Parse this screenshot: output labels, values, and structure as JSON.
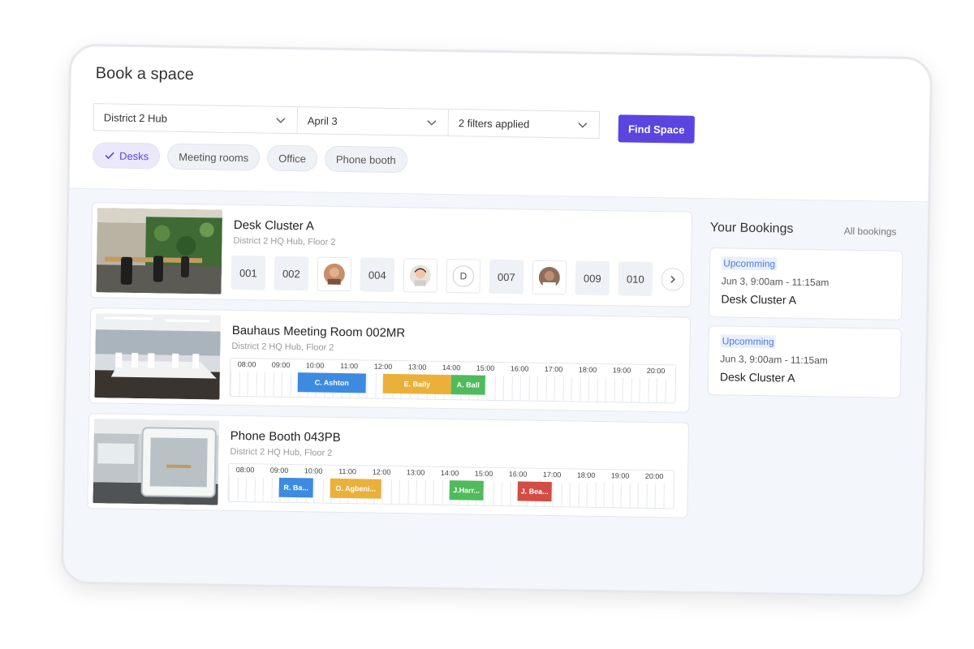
{
  "header": {
    "title": "Book a space"
  },
  "filters": {
    "location": "District 2 Hub",
    "date": "April 3",
    "filters": "2 filters applied",
    "find_label": "Find Space"
  },
  "chips": [
    {
      "label": "Desks",
      "active": true
    },
    {
      "label": "Meeting rooms",
      "active": false
    },
    {
      "label": "Office",
      "active": false
    },
    {
      "label": "Phone booth",
      "active": false
    }
  ],
  "spaces": [
    {
      "name": "Desk Cluster A",
      "location": "District 2 HQ Hub, Floor 2",
      "seats": [
        "001",
        "002",
        "",
        "004",
        "",
        "D",
        "007",
        "",
        "009",
        "010"
      ]
    },
    {
      "name": "Bauhaus Meeting Room 002MR",
      "location": "District 2 HQ Hub, Floor 2",
      "hours": [
        "08:00",
        "09:00",
        "10:00",
        "11:00",
        "12:00",
        "13:00",
        "14:00",
        "15:00",
        "16:00",
        "17:00",
        "18:00",
        "19:00",
        "20:00"
      ],
      "bookings": [
        {
          "label": "C. Ashton",
          "start": 9.5,
          "end": 11.5,
          "color": "#3d8be0"
        },
        {
          "label": "E. Baily",
          "start": 12.0,
          "end": 14.0,
          "color": "#eab03a"
        },
        {
          "label": "A. Ball",
          "start": 14.0,
          "end": 15.0,
          "color": "#4fbb5c"
        }
      ]
    },
    {
      "name": "Phone Booth 043PB",
      "location": "District 2 HQ Hub, Floor 2",
      "hours": [
        "08:00",
        "09:00",
        "10:00",
        "11:00",
        "12:00",
        "13:00",
        "14:00",
        "15:00",
        "16:00",
        "17:00",
        "18:00",
        "19:00",
        "20:00"
      ],
      "bookings": [
        {
          "label": "R. Ba...",
          "start": 9.0,
          "end": 10.0,
          "color": "#3d8be0"
        },
        {
          "label": "O. Agbeni...",
          "start": 10.5,
          "end": 12.0,
          "color": "#eab03a"
        },
        {
          "label": "J.Harr...",
          "start": 14.0,
          "end": 15.0,
          "color": "#4fbb5c"
        },
        {
          "label": "J. Bea...",
          "start": 16.0,
          "end": 17.0,
          "color": "#d24d43"
        }
      ]
    }
  ],
  "bookings_panel": {
    "title": "Your Bookings",
    "all_link": "All bookings",
    "items": [
      {
        "status": "Upcomming",
        "time": "Jun 3, 9:00am - 11:15am",
        "space": "Desk Cluster A"
      },
      {
        "status": "Upcomming",
        "time": "Jun 3, 9:00am - 11:15am",
        "space": "Desk Cluster A"
      }
    ]
  },
  "colors": {
    "accent": "#5b45e0",
    "upcoming": "#4d7be6"
  }
}
